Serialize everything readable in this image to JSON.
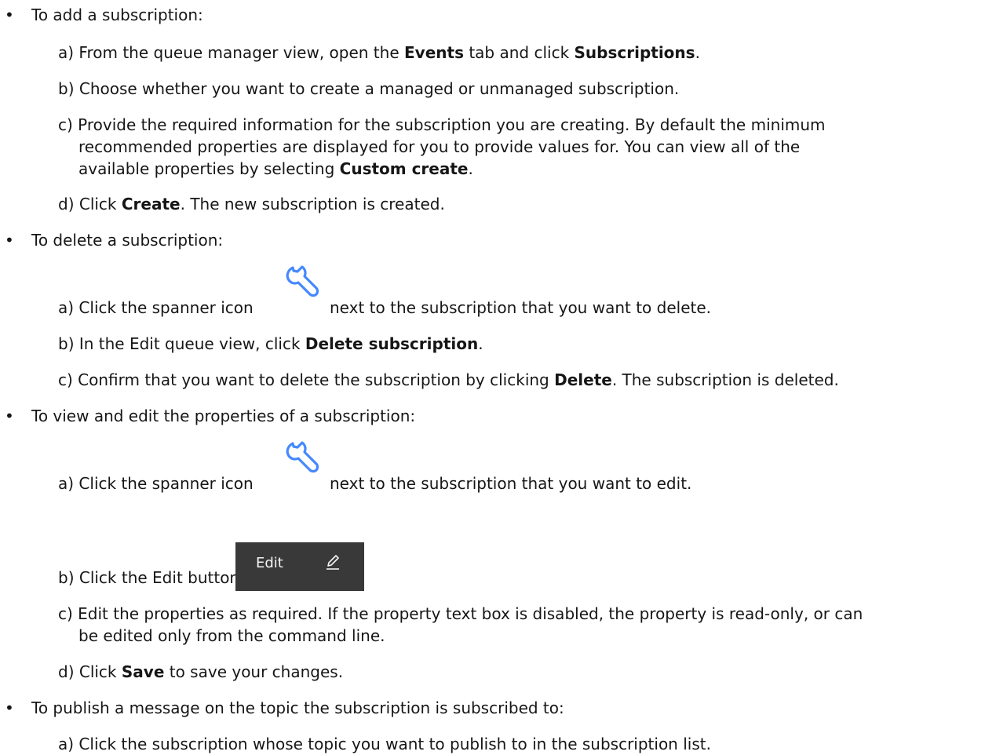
{
  "bullet_char": "•",
  "sections": [
    {
      "heading": "To add a subscription:",
      "steps": [
        {
          "pre": "a) From the queue manager view, open the ",
          "b1": "Events",
          "mid": " tab and click ",
          "b2": "Subscriptions",
          "post": "."
        },
        {
          "text": "b) Choose whether you want to create a managed or unmanaged subscription."
        },
        {
          "line1": "c) Provide the required information for the subscription you are creating. By default the minimum",
          "line2": "recommended properties are displayed for you to provide values for. You can view all of the",
          "line3_pre": "available properties by selecting ",
          "line3_bold": "Custom create",
          "line3_post": "."
        },
        {
          "pre": "d) Click ",
          "bold": "Create",
          "post": ". The new subscription is created."
        }
      ]
    },
    {
      "heading": "To delete a subscription:",
      "steps": [
        {
          "pre": "a) Click the spanner icon",
          "post": "next to the subscription that you want to delete."
        },
        {
          "pre": "b) In the Edit queue view, click ",
          "bold": "Delete subscription",
          "post": "."
        },
        {
          "pre": "c) Confirm that you want to delete the subscription by clicking ",
          "bold": "Delete",
          "post": ". The subscription is deleted."
        }
      ]
    },
    {
      "heading": "To view and edit the properties of a subscription:",
      "steps": [
        {
          "pre": "a) Click the spanner icon",
          "post": "next to the subscription that you want to edit."
        },
        {
          "text": "b) Click the Edit button",
          "button_label": "Edit"
        },
        {
          "line1": "c) Edit the properties as required. If the property text box is disabled, the property is read-only, or can",
          "line2": "be edited only from the command line."
        },
        {
          "pre": "d) Click ",
          "bold": "Save",
          "post": " to save your changes."
        }
      ]
    },
    {
      "heading": "To publish a message on the topic the subscription is subscribed to:",
      "steps": [
        {
          "text": "a) Click the subscription whose topic you want to publish to in the subscription list."
        }
      ]
    }
  ],
  "colors": {
    "text": "#161616",
    "icon": "#4589ff",
    "button_bg": "#393939",
    "button_text": "#f4f4f4"
  },
  "icons": {
    "spanner": "wrench-icon",
    "edit": "pencil-icon"
  }
}
